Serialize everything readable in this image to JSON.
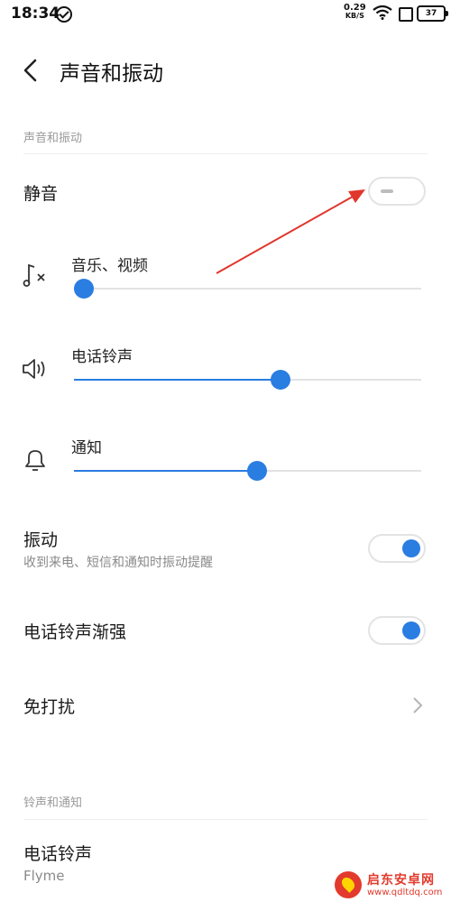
{
  "status_bar": {
    "time": "18:34",
    "net_speed_value": "0.29",
    "net_speed_unit": "KB/S",
    "battery": "37"
  },
  "header": {
    "title": "声音和振动"
  },
  "sections": {
    "sound": "声音和振动",
    "ringtone": "铃声和通知"
  },
  "mute": {
    "label": "静音",
    "on": false
  },
  "sliders": [
    {
      "label": "音乐、视频",
      "icon": "music-muted-icon",
      "value": 0
    },
    {
      "label": "电话铃声",
      "icon": "speaker-icon",
      "value": 60
    },
    {
      "label": "通知",
      "icon": "bell-icon",
      "value": 53
    }
  ],
  "vibration": {
    "label": "振动",
    "sub": "收到来电、短信和通知时振动提醒",
    "on": true
  },
  "ring_fade": {
    "label": "电话铃声渐强",
    "on": true
  },
  "dnd": {
    "label": "免打扰"
  },
  "ringtone": {
    "label": "电话铃声",
    "value": "Flyme"
  },
  "watermark": {
    "name": "启东安卓网",
    "url": "www.qdltdq.com"
  },
  "colors": {
    "accent": "#2a7de1",
    "annotation": "#e0362c"
  }
}
